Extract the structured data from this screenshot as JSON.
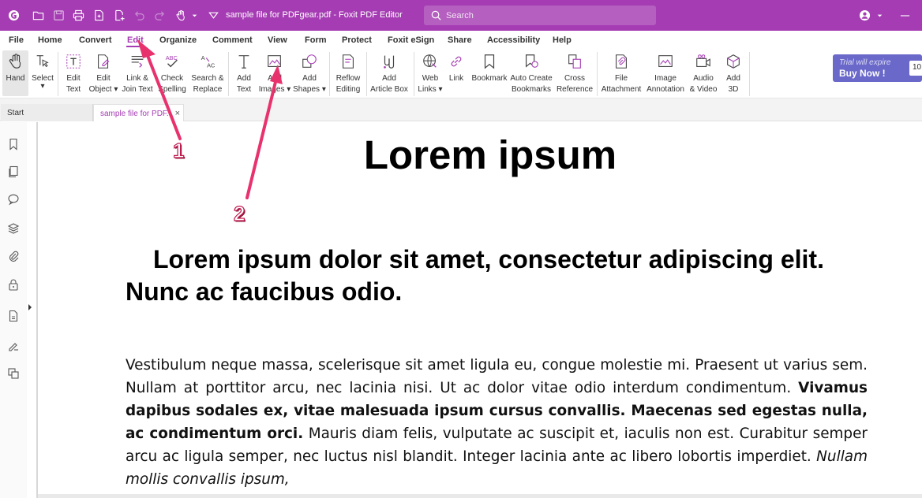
{
  "colors": {
    "brand": "#a53cb3",
    "annotation": "#e8326e",
    "trial": "#6a68c9"
  },
  "titlebar": {
    "title": "sample file for PDFgear.pdf - Foxit PDF Editor",
    "search_placeholder": "Search",
    "icons": [
      "foxit-logo-icon",
      "open-folder-icon",
      "save-icon",
      "print-icon",
      "create-icon",
      "new-icon",
      "undo-icon",
      "redo-icon",
      "hand-icon",
      "customize-icon",
      "user-icon",
      "minimize-icon"
    ]
  },
  "menu": [
    "File",
    "Home",
    "Convert",
    "Edit",
    "Organize",
    "Comment",
    "View",
    "Form",
    "Protect",
    "Foxit eSign",
    "Share",
    "Accessibility",
    "Help"
  ],
  "menu_active": "Edit",
  "ribbon": {
    "hand": [
      "Hand"
    ],
    "select": [
      "Select",
      ""
    ],
    "edit_text": [
      "Edit",
      "Text"
    ],
    "edit_object": [
      "Edit",
      "Object ▾"
    ],
    "link_join": [
      "Link &",
      "Join Text"
    ],
    "check_spelling": [
      "Check",
      "Spelling"
    ],
    "search_replace": [
      "Search &",
      "Replace"
    ],
    "add_text": [
      "Add",
      "Text"
    ],
    "add_images": [
      "Add",
      "Images ▾"
    ],
    "add_shapes": [
      "Add",
      "Shapes ▾"
    ],
    "reflow_editing": [
      "Reflow",
      "Editing"
    ],
    "add_article_box": [
      "Add",
      "Article Box"
    ],
    "web_links": [
      "Web",
      "Links ▾"
    ],
    "link": [
      "Link"
    ],
    "bookmark": [
      "Bookmark"
    ],
    "auto_create_bookmarks": [
      "Auto Create",
      "Bookmarks"
    ],
    "cross_reference": [
      "Cross",
      "Reference"
    ],
    "file_attachment": [
      "File",
      "Attachment"
    ],
    "image_annotation": [
      "Image",
      "Annotation"
    ],
    "audio_video": [
      "Audio",
      "& Video"
    ],
    "add_3d": [
      "Add",
      "3D"
    ]
  },
  "trial": {
    "line1": "Trial will expire",
    "line2": "Buy Now !",
    "days": "10"
  },
  "tabs": {
    "start": "Start",
    "document": "sample file for PDF...",
    "close": "×"
  },
  "document": {
    "title": "Lorem ipsum",
    "heading": "Lorem ipsum dolor sit amet, consectetur adipiscing elit. Nunc ac faucibus odio.",
    "p1": "Vestibulum neque massa, scelerisque sit amet ligula eu, congue molestie mi. Praesent ut varius sem. Nullam at porttitor arcu, nec lacinia nisi. Ut ac dolor vitae odio interdum condimentum.",
    "p_bold": "Vivamus dapibus sodales ex, vitae malesuada ipsum cursus convallis. Maecenas sed egestas nulla, ac condimentum orci.",
    "p2": "Mauris diam felis, vulputate ac suscipit et, iaculis non est. Curabitur semper arcu ac ligula semper, nec luctus nisl blandit. Integer lacinia ante ac libero lobortis imperdiet.",
    "p_italic": "Nullam mollis convallis ipsum,"
  },
  "annotations": {
    "n1": "1",
    "n2": "2"
  }
}
